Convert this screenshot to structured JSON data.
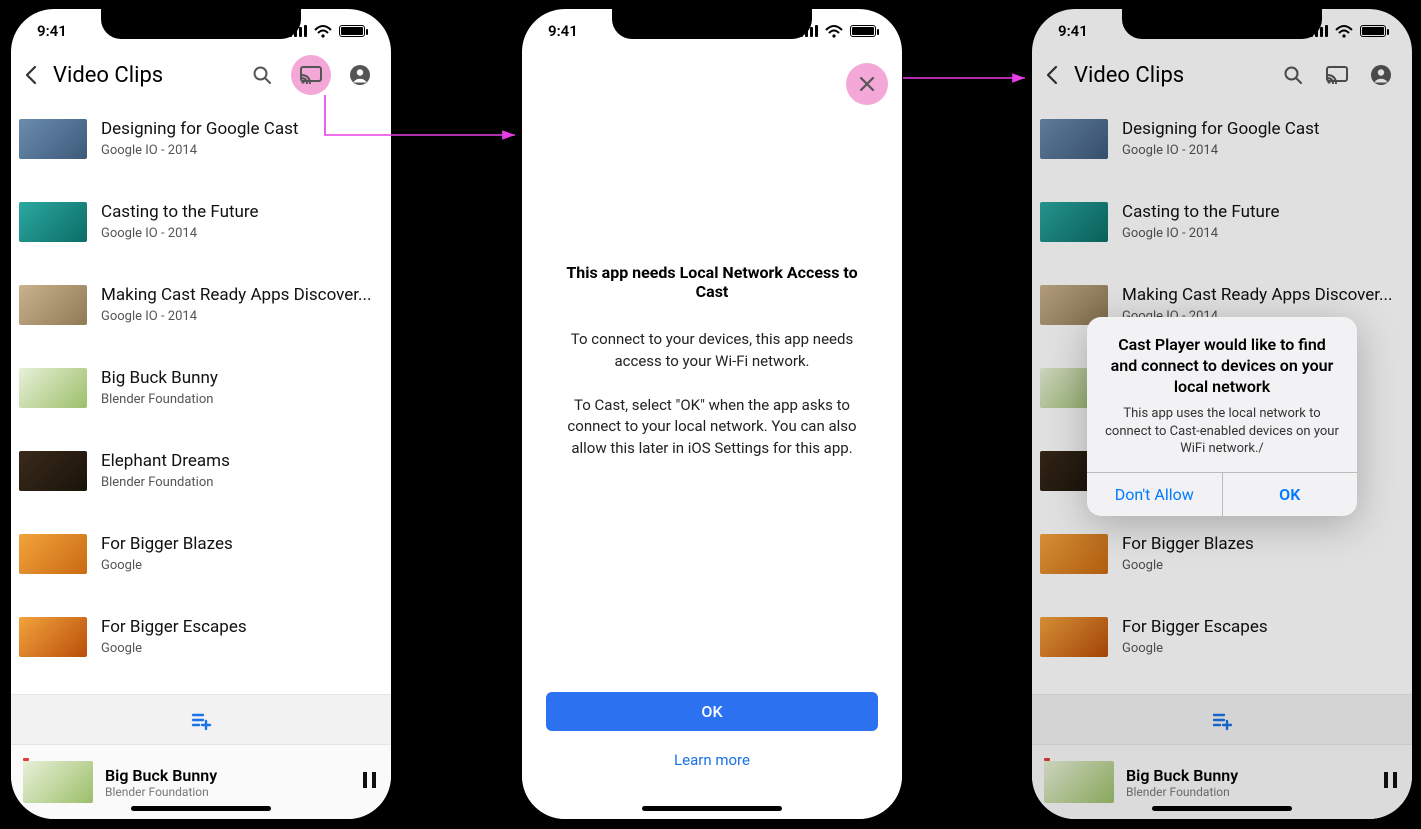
{
  "statusbar": {
    "time": "9:41"
  },
  "nav": {
    "title": "Video Clips"
  },
  "videos": [
    {
      "title": "Designing for Google Cast",
      "subtitle": "Google IO - 2014"
    },
    {
      "title": "Casting to the Future",
      "subtitle": "Google IO - 2014"
    },
    {
      "title": "Making Cast Ready Apps Discover...",
      "subtitle": "Google IO - 2014"
    },
    {
      "title": "Big Buck Bunny",
      "subtitle": "Blender Foundation"
    },
    {
      "title": "Elephant Dreams",
      "subtitle": "Blender Foundation"
    },
    {
      "title": "For Bigger Blazes",
      "subtitle": "Google"
    },
    {
      "title": "For Bigger Escapes",
      "subtitle": "Google"
    }
  ],
  "nowplaying": {
    "title": "Big Buck Bunny",
    "subtitle": "Blender Foundation"
  },
  "interstitial": {
    "heading": "This app needs Local Network Access to Cast",
    "p1": "To connect to your devices, this app needs access to your Wi-Fi network.",
    "p2": "To Cast, select \"OK\" when the app asks to connect to your local network. You can also allow this later in iOS Settings for this app.",
    "ok": "OK",
    "learn": "Learn more"
  },
  "alert": {
    "title": "Cast Player would like to find and connect to devices on your local network",
    "message": "This app uses the local network to connect to Cast-enabled devices on your WiFi network./",
    "dont": "Don't Allow",
    "ok": "OK"
  }
}
